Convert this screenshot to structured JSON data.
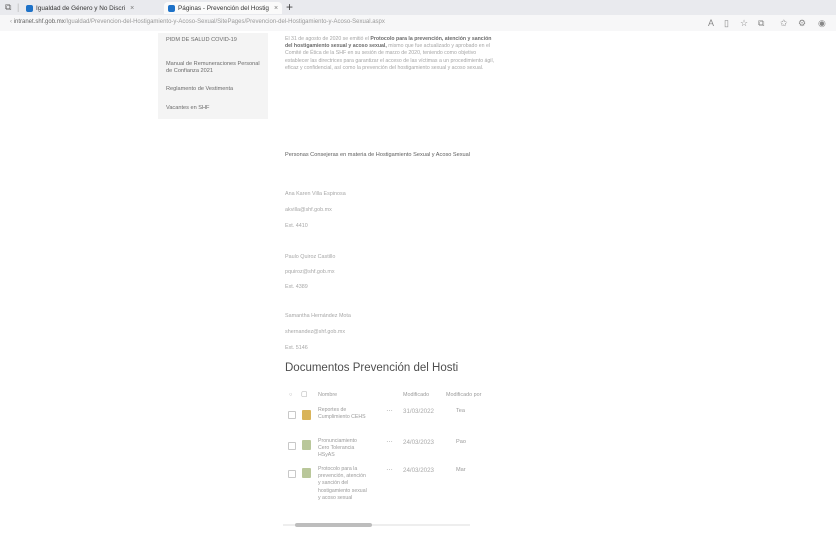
{
  "browser": {
    "tabs": [
      {
        "label": "Igualdad de Género y No Discri"
      },
      {
        "label": "Páginas - Prevención del Hostig"
      }
    ],
    "new_tab": "+",
    "url_host": "intranet.shf.gob.mx",
    "url_path": "/Igualdad/Prevencion-del-Hostigamiento-y-Acoso-Sexual/SitePages/Prevencion-del-Hostigamiento-y-Acoso-Sexual.aspx"
  },
  "sidebar": {
    "items": [
      {
        "label": "PIDM DE SALUD COVID-19"
      },
      {
        "label": "Manual de Remuneraciones Personal de Confianza 2021"
      },
      {
        "label": "Reglamento de Vestimenta"
      },
      {
        "label": "Vacantes en SHF"
      }
    ]
  },
  "intro": {
    "text_a": "El 31 de agosto de 2020 se emitió el ",
    "bold": "Protocolo para la prevención, atención y sanción del hostigamiento sexual y acoso sexual,",
    "text_b": " mismo que fue actualizado y aprobado en el Comité de Ética de la SHF en su sesión de marzo de 2020, teniendo como objetivo establecer las directrices para garantizar el acceso de las víctimas a un procedimiento ágil, eficaz y confidencial, así como la prevención del hostigamiento sexual y acoso sexual."
  },
  "consultants": {
    "heading": "Personas Consejeras en materia de Hostigamiento Sexual y Acoso Sexual",
    "people": [
      {
        "name": "Ana Karen Villa Espinosa",
        "email": "akvilla@shf.gob.mx",
        "ext": "Ext. 4410"
      },
      {
        "name": "Paulo Quiroz Castillo",
        "email": "pquiroz@shf.gob.mx",
        "ext": "Ext. 4389"
      },
      {
        "name": "Samantha Hernández Mota",
        "email": "shernandez@shf.gob.mx",
        "ext": "Ext. 5146"
      }
    ]
  },
  "documents": {
    "title": "Documentos Prevención del Hosti",
    "columns": {
      "name": "Nombre",
      "modified": "Modificado",
      "modified_by": "Modificado por"
    },
    "items": [
      {
        "name": "Reportes de Cumplimiento CEHS",
        "date": "31/03/2022",
        "by": "Tea",
        "type": "folder"
      },
      {
        "name": "Pronunciamiento Cero Tolerancia HSyAS",
        "date": "24/03/2023",
        "by": "Pao",
        "type": "document"
      },
      {
        "name": "Protocolo para la prevención, atención y sanción del hostigamiento sexual y acoso sexual",
        "date": "24/03/2023",
        "by": "Mar",
        "type": "document"
      }
    ]
  },
  "colors": {
    "accent": "#1e72c8",
    "folder": "#d9b45a",
    "document": "#b9c79a"
  }
}
